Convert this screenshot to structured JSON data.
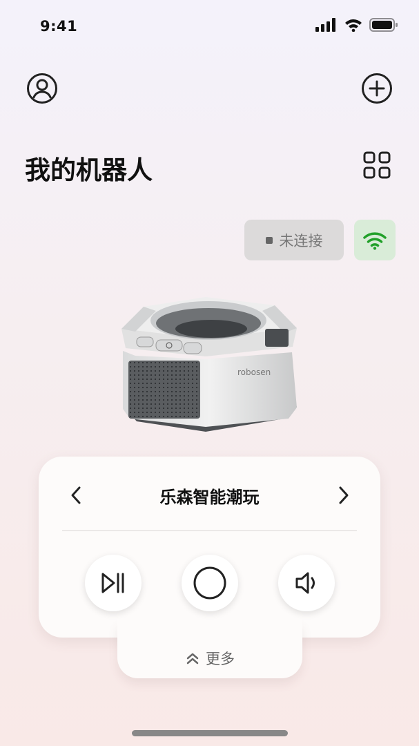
{
  "status_bar": {
    "time": "9:41",
    "icons": [
      "cellular-signal-icon",
      "wifi-icon",
      "battery-icon"
    ]
  },
  "header": {
    "profile_icon": "user-circle-icon",
    "add_icon": "plus-circle-icon"
  },
  "page": {
    "title": "我的机器人",
    "grid_icon": "grid-view-icon"
  },
  "connection": {
    "status_label": "未连接",
    "wifi_icon": "wifi-icon",
    "wifi_color": "#22a02a"
  },
  "robot_card": {
    "brand_mark": "robosen",
    "name": "乐森智能潮玩",
    "prev_icon": "chevron-left-icon",
    "next_icon": "chevron-right-icon",
    "controls": [
      {
        "name": "play-pause",
        "icon": "play-pause-icon"
      },
      {
        "name": "record",
        "icon": "circle-icon"
      },
      {
        "name": "volume",
        "icon": "speaker-icon"
      }
    ],
    "more_label": "更多",
    "more_icon": "double-chevron-up-icon"
  }
}
